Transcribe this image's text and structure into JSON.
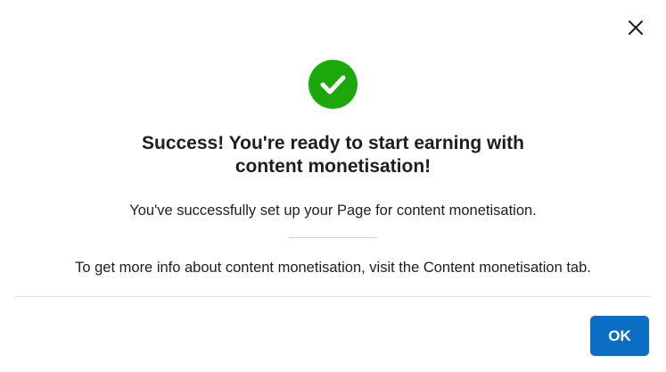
{
  "dialog": {
    "close_icon": "close-icon",
    "success_icon": "checkmark-circle-icon",
    "title_line1": "Success! You're ready to start earning with",
    "title_line2": "content monetisation!",
    "subtitle": "You've successfully set up your Page for content monetisation.",
    "info": "To get more info about content monetisation, visit the Content monetisation tab.",
    "ok_label": "OK"
  },
  "colors": {
    "success_green": "#1ca80a",
    "primary_button": "#0a6fc2",
    "text": "#1c1e21",
    "divider": "#dadde1"
  }
}
